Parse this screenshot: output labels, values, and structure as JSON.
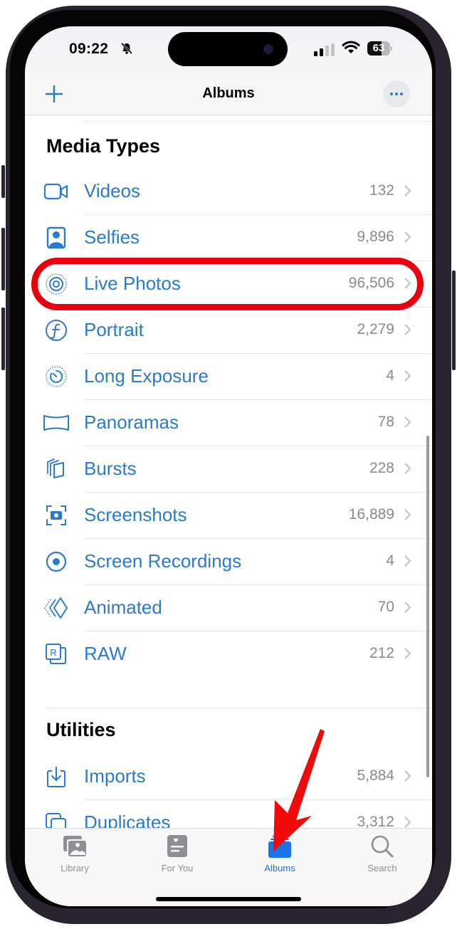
{
  "status_bar": {
    "time": "09:22",
    "silent_icon": "bell-slash-icon",
    "signal_icon": "cellular-signal-icon",
    "wifi_icon": "wifi-icon",
    "battery_percent": "63",
    "battery_level": 0.63
  },
  "nav": {
    "title": "Albums",
    "add_icon": "plus-icon",
    "more_icon": "ellipsis-icon"
  },
  "sections": [
    {
      "title": "Media Types",
      "items": [
        {
          "label": "Videos",
          "count": "132",
          "icon": "video-camera-icon"
        },
        {
          "label": "Selfies",
          "count": "9,896",
          "icon": "selfie-portrait-icon"
        },
        {
          "label": "Live Photos",
          "count": "96,506",
          "icon": "live-photo-icon"
        },
        {
          "label": "Portrait",
          "count": "2,279",
          "icon": "portrait-f-icon"
        },
        {
          "label": "Long Exposure",
          "count": "4",
          "icon": "long-exposure-timer-icon"
        },
        {
          "label": "Panoramas",
          "count": "78",
          "icon": "panorama-icon"
        },
        {
          "label": "Bursts",
          "count": "228",
          "icon": "burst-stack-icon"
        },
        {
          "label": "Screenshots",
          "count": "16,889",
          "icon": "screenshot-camera-icon"
        },
        {
          "label": "Screen Recordings",
          "count": "4",
          "icon": "record-circle-icon"
        },
        {
          "label": "Animated",
          "count": "70",
          "icon": "animated-diamond-icon"
        },
        {
          "label": "RAW",
          "count": "212",
          "icon": "raw-icon"
        }
      ]
    },
    {
      "title": "Utilities",
      "items": [
        {
          "label": "Imports",
          "count": "5,884",
          "icon": "import-tray-icon"
        },
        {
          "label": "Duplicates",
          "count": "3,312",
          "icon": "duplicates-icon"
        }
      ]
    }
  ],
  "tab_bar": {
    "tabs": [
      {
        "label": "Library",
        "icon": "photo-library-icon",
        "active": false
      },
      {
        "label": "For You",
        "icon": "for-you-heart-icon",
        "active": false
      },
      {
        "label": "Albums",
        "icon": "albums-stack-icon",
        "active": true
      },
      {
        "label": "Search",
        "icon": "magnifier-icon",
        "active": false
      }
    ]
  },
  "annotations": {
    "highlight_target": "Live Photos",
    "highlight_color": "#e8000e",
    "arrow_target": "Albums",
    "arrow_color": "#f00a0a"
  },
  "colors": {
    "accent": "#2a7ad0",
    "count_gray": "#8a8a8e",
    "tab_active": "#1a73e8",
    "tab_inactive": "#8e8e93"
  }
}
